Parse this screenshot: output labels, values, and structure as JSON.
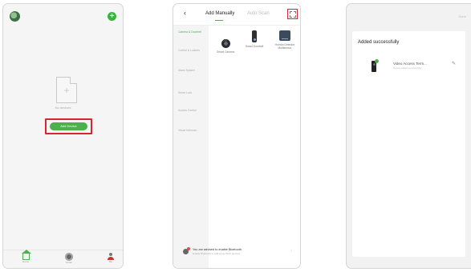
{
  "phone1": {
    "empty_text": "No devices",
    "add_button": "Add Device",
    "tabs": [
      {
        "label": "Home",
        "icon": "home-icon"
      },
      {
        "label": "Smart",
        "icon": "smart-icon"
      },
      {
        "label": "Me",
        "icon": "me-icon"
      }
    ]
  },
  "phone2": {
    "tab_manual": "Add Manually",
    "tab_auto": "Auto Scan",
    "categories": [
      "Camera & Doorbell",
      "Control & Lockers",
      "Alarm System",
      "Smart Lock",
      "Access Control",
      "Visual Intercom"
    ],
    "devices": [
      {
        "label": "Smart Camera",
        "icon": "camera-icon"
      },
      {
        "label": "Smart Doorbell",
        "icon": "doorbell-icon"
      },
      {
        "label": "Human Detector Multisensor",
        "icon": "gateway-icon"
      }
    ],
    "bluetooth_title": "You are advised to enable Bluetooth.",
    "bluetooth_sub": "Enable Bluetooth to add some Wi-Fi devices."
  },
  "phone3": {
    "done": "Done",
    "title": "Added successfully",
    "device_name": "Video Access Term...",
    "device_status": "Device added successfully"
  },
  "colors": {
    "accent_green": "#4eb04c",
    "highlight_red": "#d9262d"
  }
}
